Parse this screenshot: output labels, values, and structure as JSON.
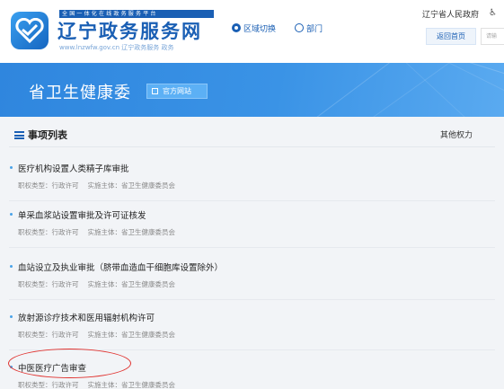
{
  "header": {
    "logo_tagline": "全国一体化在线政务服务平台",
    "logo_title": "辽宁政务服务网",
    "logo_subtitle": "www.lnzwfw.gov.cn 辽宁政务服务 政务",
    "region_switch": "区域切换",
    "department": "部门",
    "gov_link": "辽宁省人民政府",
    "home_button": "返回首页",
    "search_placeholder": "请输"
  },
  "banner": {
    "title": "省卫生健康委",
    "official_site": "官方网站"
  },
  "list": {
    "title": "事项列表",
    "other_powers": "其他权力",
    "items": [
      {
        "title": "医疗机构设置人类精子库审批",
        "type_label": "职权类型：行政许可",
        "agency_label": "实施主体：省卫生健康委员会"
      },
      {
        "title": "单采血浆站设置审批及许可证核发",
        "type_label": "职权类型：行政许可",
        "agency_label": "实施主体：省卫生健康委员会"
      },
      {
        "title": "血站设立及执业审批（脐带血造血干细胞库设置除外）",
        "type_label": "职权类型：行政许可",
        "agency_label": "实施主体：省卫生健康委员会"
      },
      {
        "title": "放射源诊疗技术和医用辐射机构许可",
        "type_label": "职权类型：行政许可",
        "agency_label": "实施主体：省卫生健康委员会"
      },
      {
        "title": "中医医疗广告审查",
        "type_label": "职权类型：行政许可",
        "agency_label": "实施主体：省卫生健康委员会"
      }
    ]
  },
  "colors": {
    "brand": "#1a5fb4",
    "banner": "#2f86de",
    "highlight": "#e0322f"
  },
  "icons": [
    "logo-heart-icon",
    "location-pin-icon",
    "department-icon",
    "accessibility-icon",
    "official-site-icon",
    "list-icon"
  ]
}
